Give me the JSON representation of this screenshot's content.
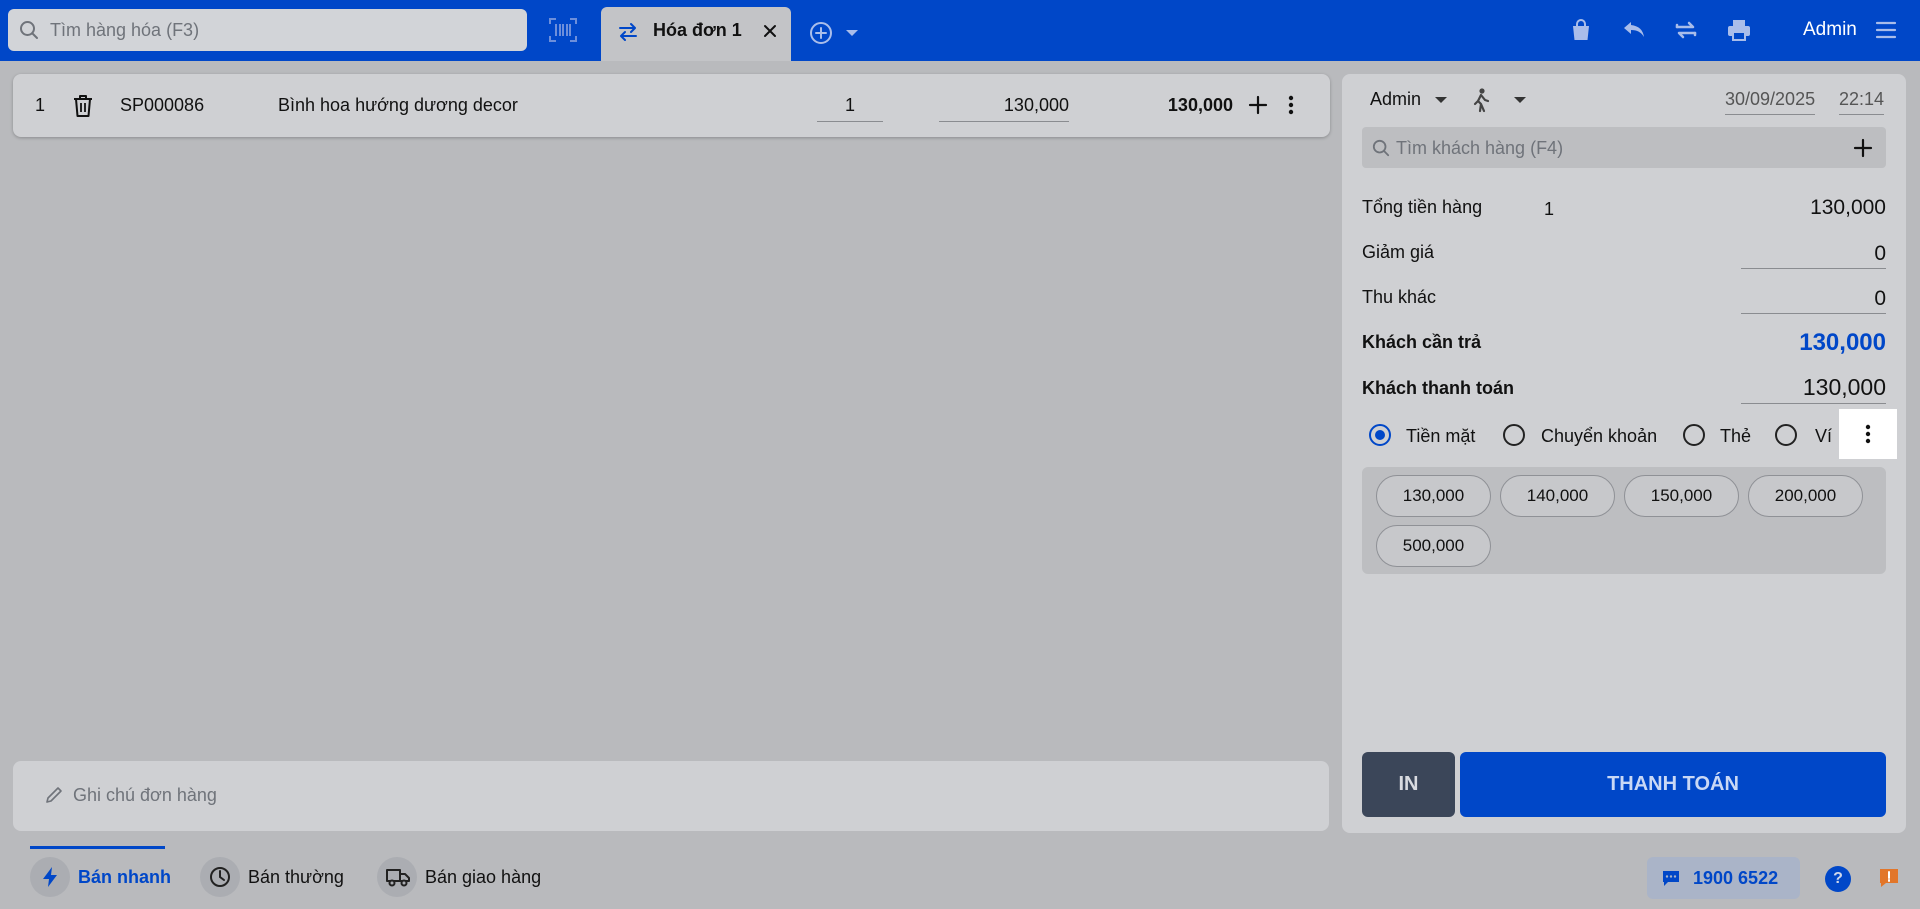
{
  "topbar": {
    "search_placeholder": "Tìm hàng hóa (F3)",
    "tab_label": "Hóa đơn 1",
    "user": "Admin"
  },
  "cart": {
    "items": [
      {
        "index": "1",
        "code": "SP000086",
        "name": "Bình hoa hướng dương decor",
        "quantity": "1",
        "unit_price": "130,000",
        "total": "130,000"
      }
    ]
  },
  "note": {
    "placeholder": "Ghi chú đơn hàng"
  },
  "panel": {
    "seller": "Admin",
    "date": "30/09/2025",
    "time": "22:14",
    "customer_search_placeholder": "Tìm khách hàng (F4)",
    "subtotal_label": "Tổng tiền hàng",
    "subtotal_count": "1",
    "subtotal_value": "130,000",
    "discount_label": "Giảm giá",
    "discount_value": "0",
    "other_fee_label": "Thu khác",
    "other_fee_value": "0",
    "due_label": "Khách cần trả",
    "due_value": "130,000",
    "paid_label": "Khách thanh toán",
    "paid_value": "130,000",
    "payment_methods": [
      {
        "label": "Tiền mặt",
        "selected": true
      },
      {
        "label": "Chuyển khoản",
        "selected": false
      },
      {
        "label": "Thẻ",
        "selected": false
      },
      {
        "label": "Ví",
        "selected": false
      }
    ],
    "quick_amounts": [
      "130,000",
      "140,000",
      "150,000",
      "200,000",
      "500,000"
    ],
    "print_button": "IN",
    "pay_button": "THANH TOÁN"
  },
  "bottom": {
    "nav": [
      "Bán nhanh",
      "Bán thường",
      "Bán giao hàng"
    ],
    "hotline": "1900 6522",
    "help": "?"
  },
  "colors": {
    "brand": "#0047c8",
    "due_value": "#0047c8"
  }
}
